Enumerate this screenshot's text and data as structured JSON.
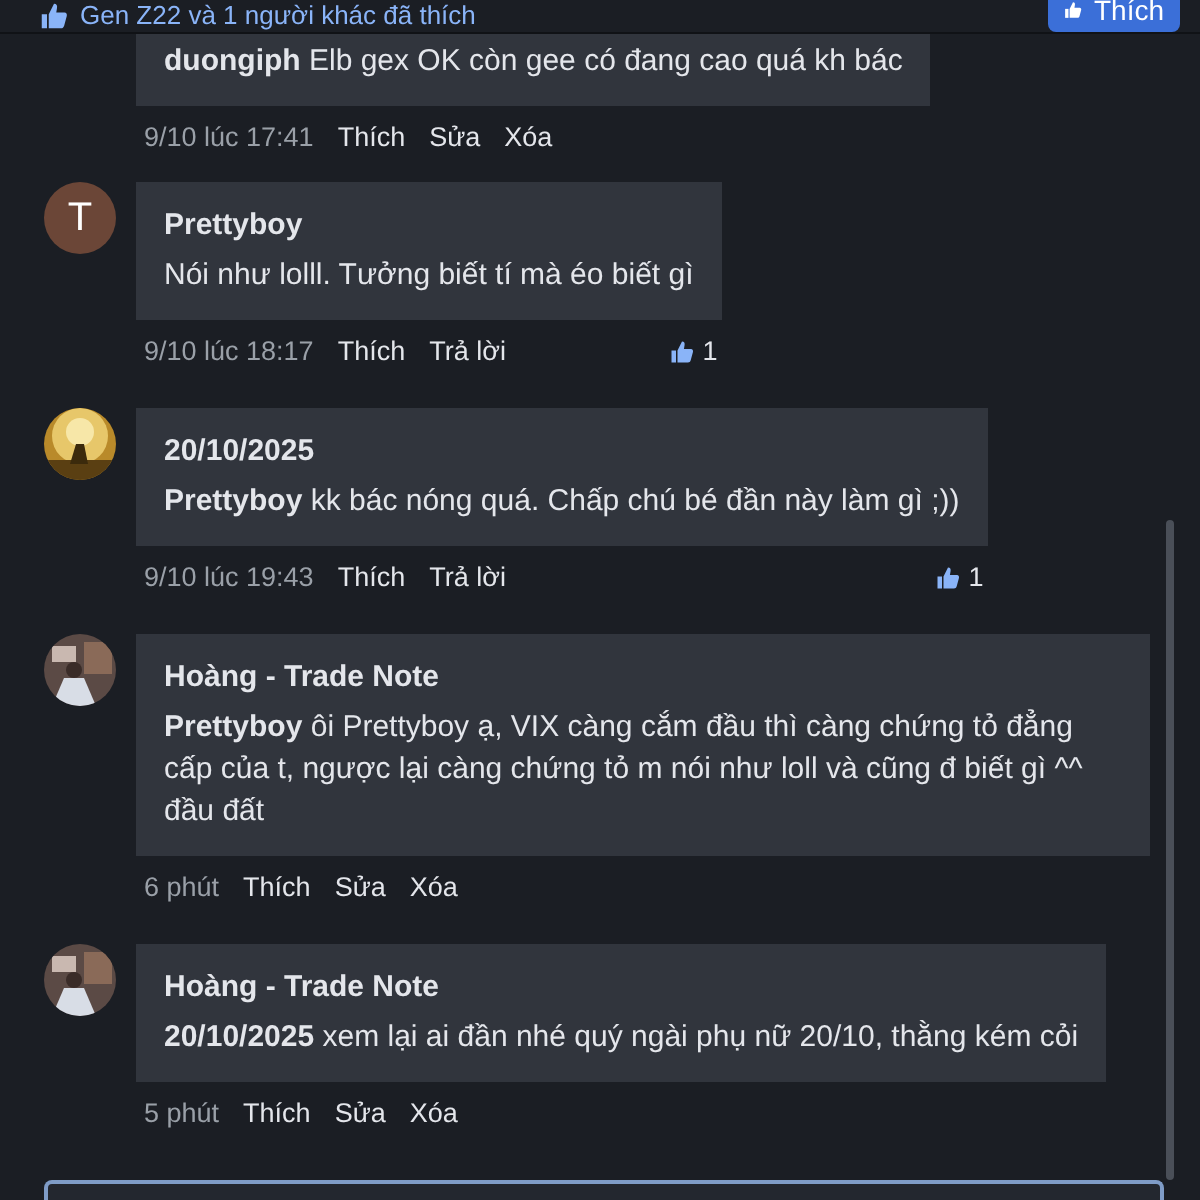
{
  "top_bar": {
    "likes_text": "Gen Z22 và 1 người khác đã thích",
    "like_button": {
      "label": "Thích"
    }
  },
  "comments": [
    {
      "avatar": {
        "kind": "none"
      },
      "text": "**duongiph** Elb gex OK còn gee có đang cao quá kh bác",
      "time": "9/10 lúc 17:41",
      "actions": [
        "Thích",
        "Sửa",
        "Xóa"
      ]
    },
    {
      "avatar": {
        "kind": "letter",
        "letter": "T",
        "color": "#6b4637"
      },
      "author": "Prettyboy",
      "text": "Nói như lolll. Tưởng biết tí mà éo biết gì",
      "time": "9/10 lúc 18:17",
      "actions": [
        "Thích",
        "Trả lời"
      ],
      "likes": "1"
    },
    {
      "avatar": {
        "kind": "picture"
      },
      "author": "20/10/2025",
      "text": "**Prettyboy** kk bác nóng quá. Chấp chú bé đần này làm gì ;))",
      "time": "9/10 lúc 19:43",
      "actions": [
        "Thích",
        "Trả lời"
      ],
      "likes": "1"
    },
    {
      "avatar": {
        "kind": "picture"
      },
      "author": "Hoàng - Trade Note",
      "text": "**Prettyboy** ôi Prettyboy ạ, VIX càng cắm đầu thì càng chứng tỏ đẳng cấp của t, ngược lại càng chứng tỏ m nói như loll và cũng đ biết gì ^^ đầu đất",
      "time": "6 phút",
      "actions": [
        "Thích",
        "Sửa",
        "Xóa"
      ]
    },
    {
      "avatar": {
        "kind": "picture"
      },
      "author": "Hoàng - Trade Note",
      "text": "**20/10/2025** xem lại ai đần nhé quý ngài phụ nữ 20/10, thằng kém cỏi",
      "time": "5 phút",
      "actions": [
        "Thích",
        "Sửa",
        "Xóa"
      ]
    }
  ]
}
